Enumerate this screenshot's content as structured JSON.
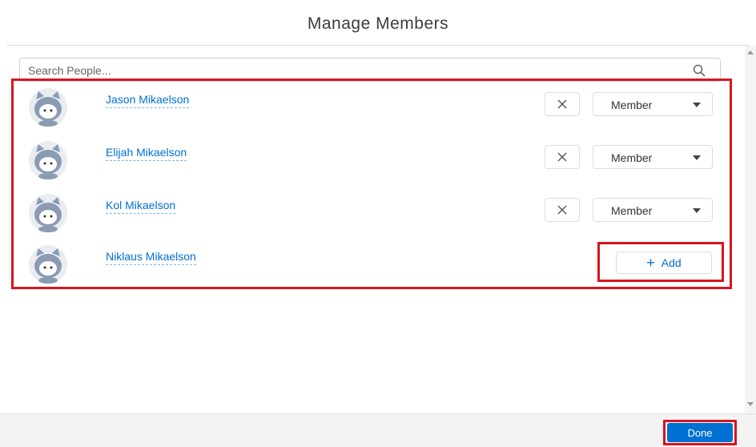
{
  "modal": {
    "title": "Manage Members"
  },
  "search": {
    "placeholder": "Search People..."
  },
  "members": [
    {
      "name": "Jason Mikaelson",
      "role": "Member",
      "remove_label": "✕"
    },
    {
      "name": "Elijah Mikaelson",
      "role": "Member",
      "remove_label": "✕"
    },
    {
      "name": "Kol Mikaelson",
      "role": "Member",
      "remove_label": "✕"
    },
    {
      "name": "Niklaus Mikaelson",
      "add_icon": "+",
      "add_label": "Add"
    }
  ],
  "footer": {
    "done_label": "Done"
  },
  "colors": {
    "link": "#0070d2",
    "primary": "#0070d2",
    "highlight": "#d9141e",
    "avatar": "#8a9bb2"
  }
}
